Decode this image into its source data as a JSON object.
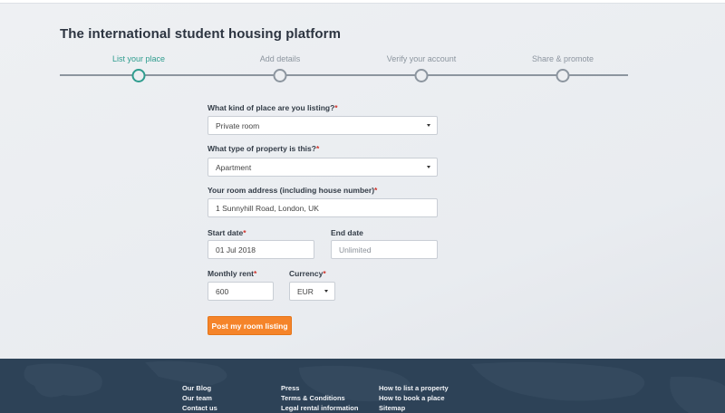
{
  "header": {
    "title": "The international student housing platform"
  },
  "stepper": {
    "steps": [
      {
        "label": "List your place",
        "active": true
      },
      {
        "label": "Add details",
        "active": false
      },
      {
        "label": "Verify your account",
        "active": false
      },
      {
        "label": "Share & promote",
        "active": false
      }
    ]
  },
  "form": {
    "kind": {
      "label": "What kind of place are you listing?",
      "value": "Private room"
    },
    "type": {
      "label": "What type of property is this?",
      "value": "Apartment"
    },
    "address": {
      "label": "Your room address (including house number)",
      "value": "1 Sunnyhill Road, London, UK"
    },
    "start_date": {
      "label": "Start date",
      "value": "01 Jul 2018"
    },
    "end_date": {
      "label": "End date",
      "placeholder": "Unlimited"
    },
    "rent": {
      "label": "Monthly rent",
      "value": "600"
    },
    "currency": {
      "label": "Currency",
      "value": "EUR"
    },
    "required_mark": "*",
    "submit_label": "Post my room listing"
  },
  "footer": {
    "col1": [
      "Our Blog",
      "Our team",
      "Contact us"
    ],
    "col2": [
      "Press",
      "Terms & Conditions",
      "Legal rental information"
    ],
    "col3": [
      "How to list a property",
      "How to book a place",
      "Sitemap"
    ]
  },
  "colors": {
    "accent": "#2e9c8e",
    "button": "#f5842a",
    "footer": "#2d4257",
    "required": "#d0342c"
  }
}
